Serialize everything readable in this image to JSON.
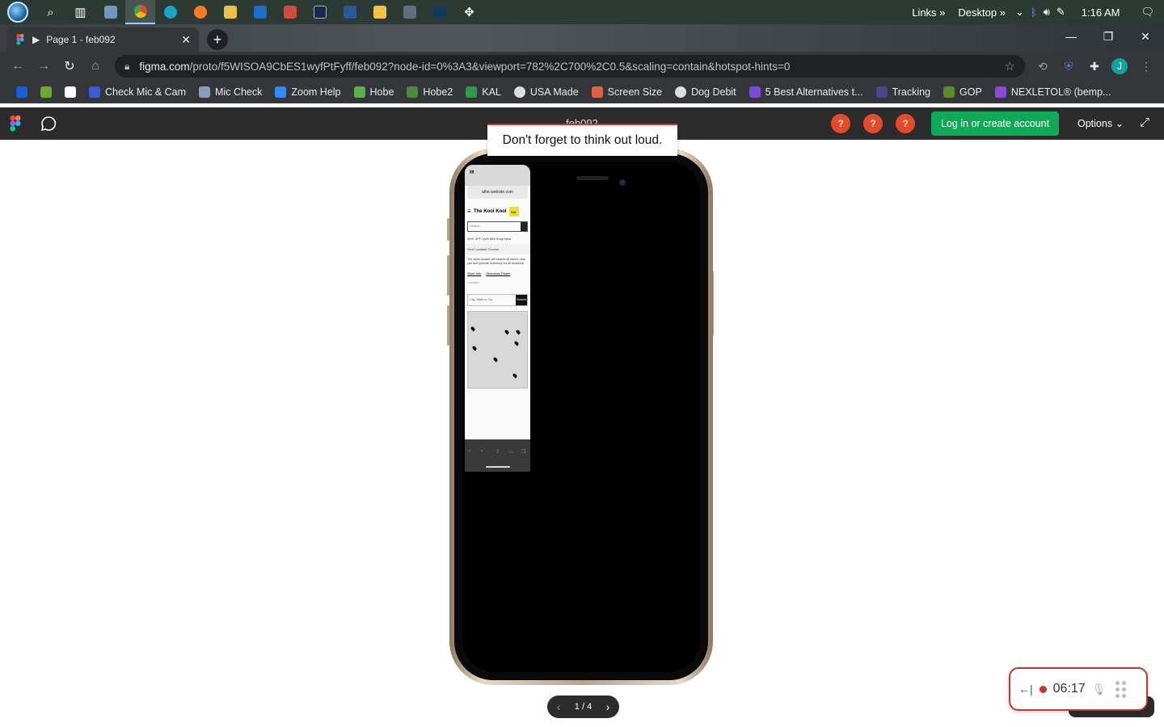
{
  "taskbar": {
    "apps": [
      "search-icon",
      "task-view-icon",
      "photos-icon",
      "chrome-icon",
      "edge-icon",
      "firefox-icon",
      "app-icon",
      "outlook-icon",
      "app-icon",
      "app-icon",
      "word-icon",
      "file-explorer-icon",
      "calculator-icon",
      "app-icon",
      "app-icon"
    ],
    "links_label": "Links",
    "desktop_label": "Desktop",
    "clock": "1:16 AM"
  },
  "browser": {
    "tab_title": "Page 1 - feb092",
    "url_host": "figma.com",
    "url_path": "/proto/f5WISOA9CbES1wyfPtFyff/feb092?node-id=0%3A3&viewport=782%2C700%2C0.5&scaling=contain&hotspot-hints=0",
    "avatar_letter": "J",
    "bookmarks": [
      {
        "label": "",
        "icon": "bitwarden-icon",
        "color": "#175ddc"
      },
      {
        "label": "",
        "icon": "ui-icon",
        "color": "#6aaa2c"
      },
      {
        "label": "",
        "icon": "q-icon",
        "color": "#ffffff"
      },
      {
        "label": "Check Mic & Cam",
        "icon": "mic-cam-icon",
        "color": "#3b5bdb"
      },
      {
        "label": "Mic Check",
        "icon": "mic-check-icon",
        "color": "#8a9bb5"
      },
      {
        "label": "Zoom Help",
        "icon": "zoom-icon",
        "color": "#2d8cff"
      },
      {
        "label": "Hobe",
        "icon": "hobe-icon",
        "color": "#5bb24a"
      },
      {
        "label": "Hobe2",
        "icon": "hobe2-icon",
        "color": "#4a8a3a"
      },
      {
        "label": "KAL",
        "icon": "kal-icon",
        "color": "#2e9a4a"
      },
      {
        "label": "USA Made",
        "icon": "globe-icon",
        "color": "#dddddd"
      },
      {
        "label": "Screen Size",
        "icon": "screen-size-icon",
        "color": "#e06040"
      },
      {
        "label": "Dog Debit",
        "icon": "globe-icon",
        "color": "#dddddd"
      },
      {
        "label": "5 Best Alternatives t...",
        "icon": "alt-icon",
        "color": "#7a4ad8"
      },
      {
        "label": "Tracking",
        "icon": "tracking-icon",
        "color": "#444a8a"
      },
      {
        "label": "GOP",
        "icon": "gop-icon",
        "color": "#5a8a2a"
      },
      {
        "label": "NEXLETOL® (bemp...",
        "icon": "nexletol-icon",
        "color": "#8a4ad8"
      }
    ]
  },
  "figma": {
    "title": "feb092",
    "help_labels": [
      "?",
      "?",
      "?"
    ],
    "login_label": "Log in or create account",
    "options_label": "Options",
    "tooltip": "Don't forget to think out loud.",
    "pager": "1 / 4"
  },
  "mini_site": {
    "url": "athe.website.com",
    "logo": "The Kool Kool",
    "badge": "SAL",
    "search_placeholder": "Search",
    "promo": "20% OFF Over $45  Shop Now",
    "location": "Your Location  Choose",
    "paragraph": "The store locator will search all stores near you and provide inventory for all locations",
    "link1": "Store Info",
    "link2": "Directions Picker",
    "zip_label": "Location",
    "zip_value": "City, State or Zip",
    "go_label": "Search"
  },
  "recorder": {
    "time": "06:17"
  }
}
